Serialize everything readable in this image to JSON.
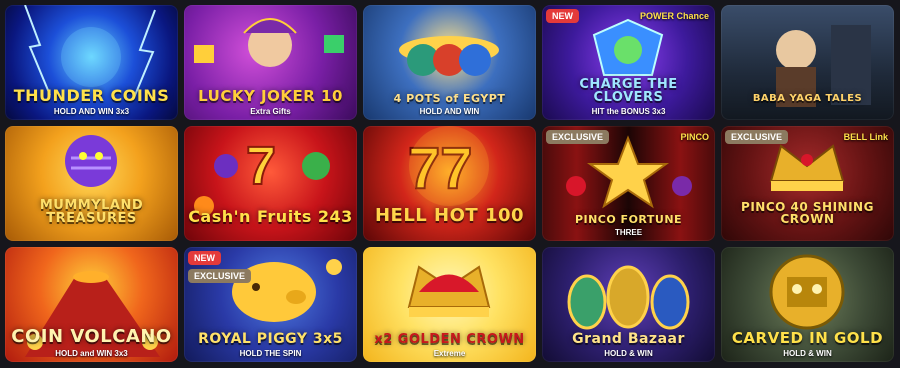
{
  "games": [
    {
      "title": "THUNDER COINS",
      "subtitle": "HOLD AND WIN 3x3",
      "badges": [],
      "title_color": "#ffe14a",
      "title_size": "16px"
    },
    {
      "title": "LUCKY JOKER 10",
      "subtitle": "Extra Gifts",
      "badges": [],
      "title_color": "#ffce3a",
      "title_size": "15px"
    },
    {
      "title": "4 POTS of EGYPT",
      "subtitle": "HOLD AND WIN",
      "badges": [],
      "title_color": "#ffe08a",
      "title_size": "11px"
    },
    {
      "title": "CHARGE THE CLOVERS",
      "subtitle": "HIT the BONUS 3x3",
      "badges": [
        "NEW"
      ],
      "title_color": "#9fe7ff",
      "title_size": "13px",
      "extra": "POWER Chance"
    },
    {
      "title": "BABA YAGA TALES",
      "subtitle": "",
      "badges": [],
      "title_color": "#ffd36a",
      "title_size": "10px"
    },
    {
      "title": "MUMMYLAND TREASURES",
      "subtitle": "",
      "badges": [],
      "title_color": "#ffe06a",
      "title_size": "13px"
    },
    {
      "title": "Cash'n Fruits 243",
      "subtitle": "",
      "badges": [],
      "title_color": "#ffe14a",
      "title_size": "16px"
    },
    {
      "title": "HELL HOT 100",
      "subtitle": "",
      "badges": [],
      "title_color": "#ffd44a",
      "title_size": "18px"
    },
    {
      "title": "PINCO FORTUNE",
      "subtitle": "THREE",
      "badges": [
        "EXCLUSIVE"
      ],
      "title_color": "#ffe16a",
      "title_size": "11px",
      "extra": "PINCO"
    },
    {
      "title": "PINCO 40 SHINING CROWN",
      "subtitle": "",
      "badges": [
        "EXCLUSIVE"
      ],
      "title_color": "#ffdf6a",
      "title_size": "12px",
      "extra": "BELL Link"
    },
    {
      "title": "COIN VOLCANO",
      "subtitle": "HOLD and WIN 3x3",
      "badges": [],
      "title_color": "#fff3b0",
      "title_size": "18px"
    },
    {
      "title": "ROYAL PIGGY 3x5",
      "subtitle": "HOLD THE SPIN",
      "badges": [
        "NEW",
        "EXCLUSIVE"
      ],
      "title_color": "#ffe16a",
      "title_size": "14px"
    },
    {
      "title": "x2 GOLDEN CROWN",
      "subtitle": "Extreme",
      "badges": [],
      "title_color": "#c7181c",
      "title_size": "13px"
    },
    {
      "title": "Grand Bazaar",
      "subtitle": "HOLD & WIN",
      "badges": [],
      "title_color": "#ffe38a",
      "title_size": "14px"
    },
    {
      "title": "CARVED IN GOLD",
      "subtitle": "HOLD & WIN",
      "badges": [],
      "title_color": "#ffe14a",
      "title_size": "15px"
    }
  ],
  "colors": {
    "background": "#16161c",
    "badge_new": "#e43a3a",
    "badge_exclusive": "#8c7a60"
  }
}
